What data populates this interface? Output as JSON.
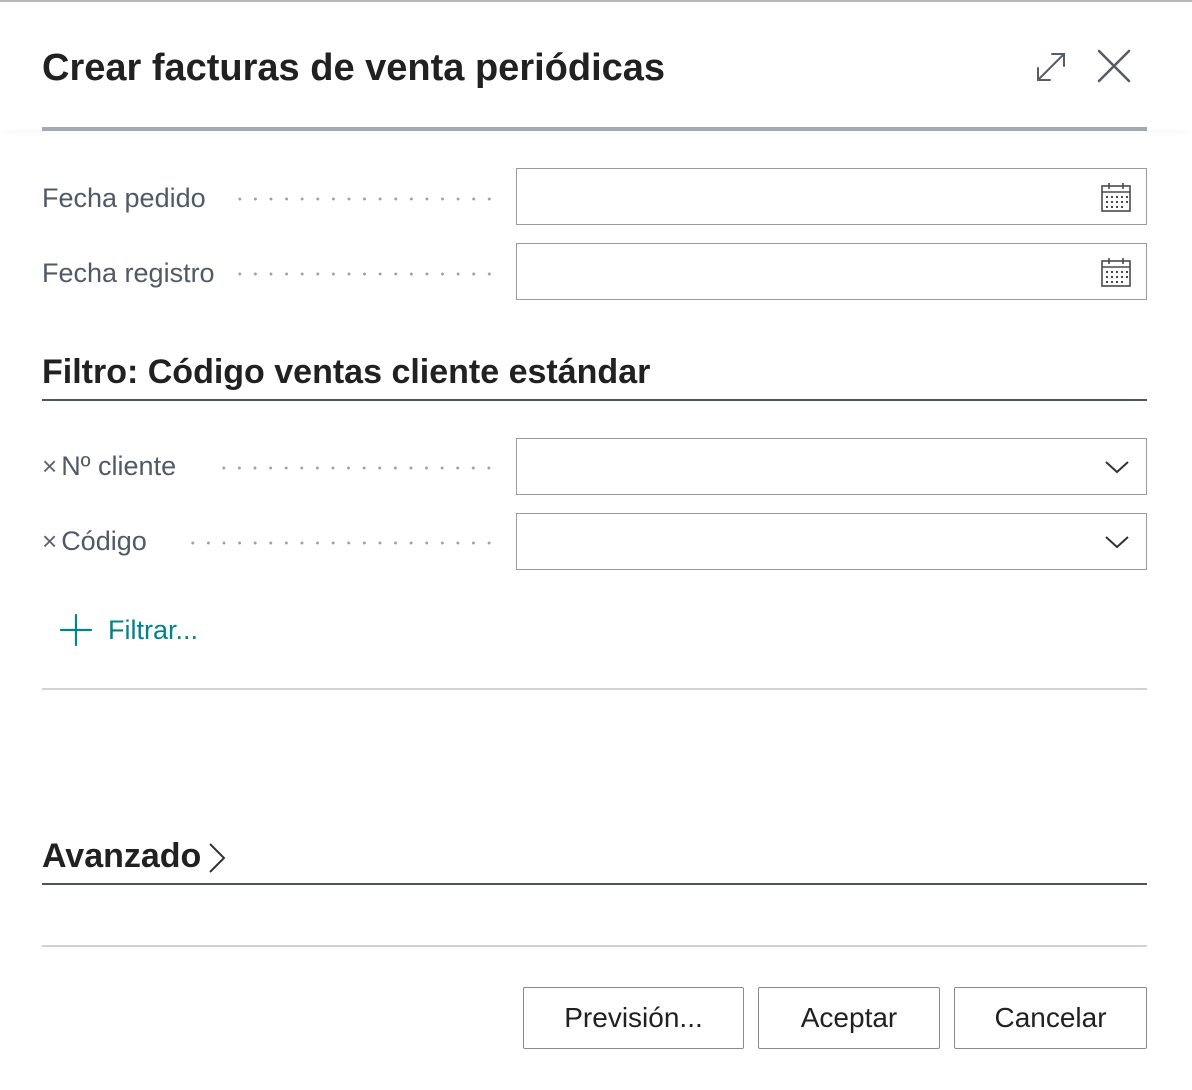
{
  "dialog": {
    "title": "Crear facturas de venta periódicas",
    "expand_icon": "expand-arrows-icon",
    "close_icon": "close-icon"
  },
  "options": {
    "fields": [
      {
        "label": "Fecha pedido",
        "value": "",
        "icon": "calendar-icon"
      },
      {
        "label": "Fecha registro",
        "value": "",
        "icon": "calendar-icon"
      }
    ]
  },
  "filter": {
    "title": "Filtro: Código ventas cliente estándar",
    "fields": [
      {
        "remove": "×",
        "label": "Nº cliente",
        "value": "",
        "icon": "chevron-down-icon"
      },
      {
        "remove": "×",
        "label": "Código",
        "value": "",
        "icon": "chevron-down-icon"
      }
    ],
    "add_label": "Filtrar..."
  },
  "advanced": {
    "title": "Avanzado"
  },
  "footer": {
    "preview_label": "Previsión...",
    "ok_label": "Aceptar",
    "cancel_label": "Cancelar"
  },
  "colors": {
    "accent": "#008489",
    "label": "#505a66",
    "rule_dark": "#4a5360",
    "rule_light": "#cfd2d6"
  }
}
